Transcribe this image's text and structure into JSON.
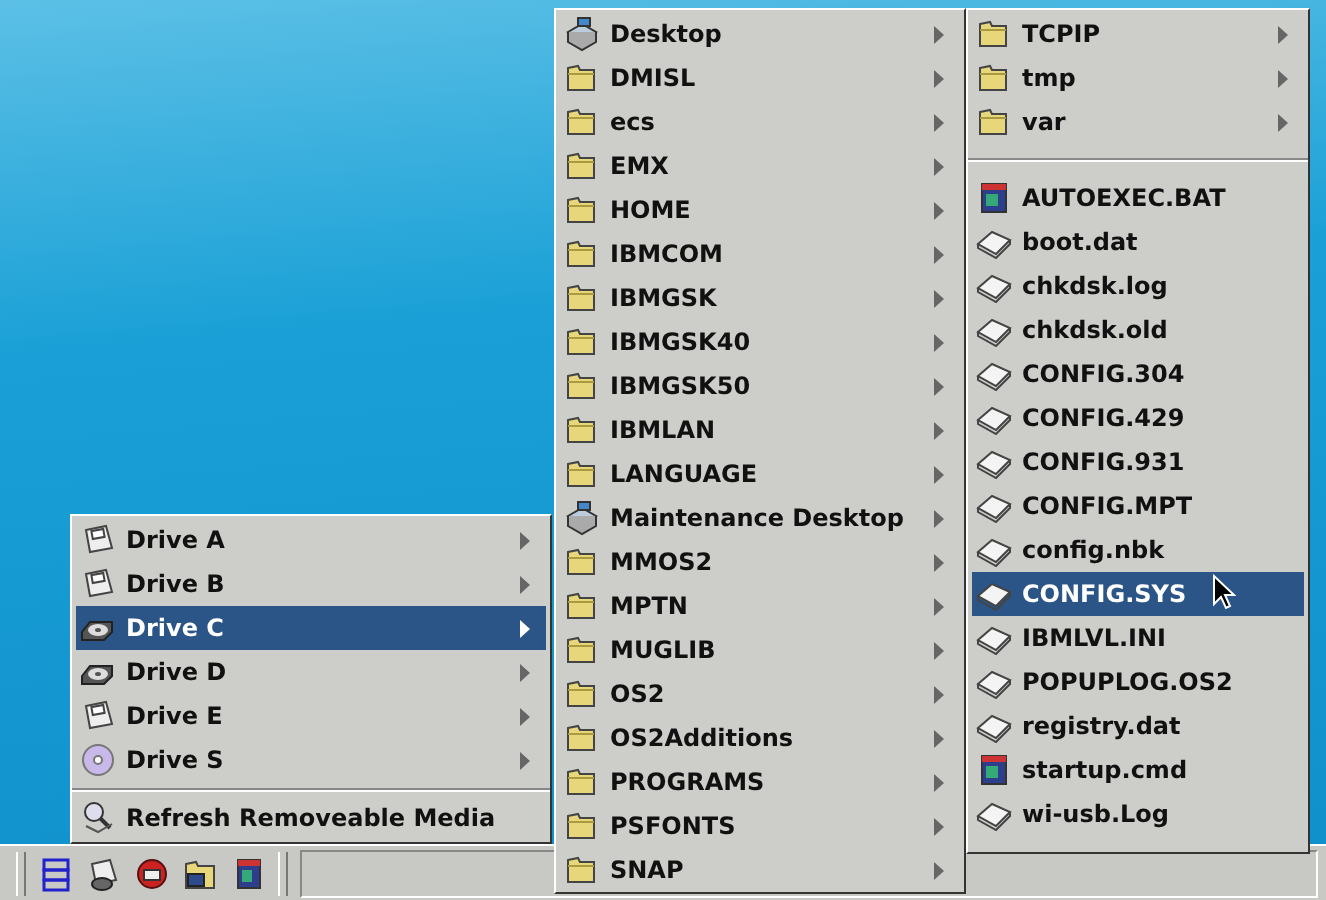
{
  "drives_menu": {
    "items": [
      {
        "label": "Drive A",
        "kind": "floppy",
        "submenu": true,
        "selected": false
      },
      {
        "label": "Drive B",
        "kind": "floppy",
        "submenu": true,
        "selected": false
      },
      {
        "label": "Drive C",
        "kind": "hard-disk",
        "submenu": true,
        "selected": true
      },
      {
        "label": "Drive D",
        "kind": "hard-disk",
        "submenu": true,
        "selected": false
      },
      {
        "label": "Drive E",
        "kind": "floppy",
        "submenu": true,
        "selected": false
      },
      {
        "label": "Drive S",
        "kind": "cd",
        "submenu": true,
        "selected": false
      }
    ],
    "actions": [
      {
        "label": "Refresh Removeable Media",
        "kind": "refresh",
        "submenu": false,
        "selected": false
      }
    ]
  },
  "folders_menu": {
    "items": [
      {
        "label": "Desktop",
        "kind": "desktop",
        "submenu": true,
        "selected": false
      },
      {
        "label": "DMISL",
        "kind": "folder",
        "submenu": true,
        "selected": false
      },
      {
        "label": "ecs",
        "kind": "folder",
        "submenu": true,
        "selected": false
      },
      {
        "label": "EMX",
        "kind": "folder",
        "submenu": true,
        "selected": false
      },
      {
        "label": "HOME",
        "kind": "folder",
        "submenu": true,
        "selected": false
      },
      {
        "label": "IBMCOM",
        "kind": "folder",
        "submenu": true,
        "selected": false
      },
      {
        "label": "IBMGSK",
        "kind": "folder",
        "submenu": true,
        "selected": false
      },
      {
        "label": "IBMGSK40",
        "kind": "folder",
        "submenu": true,
        "selected": false
      },
      {
        "label": "IBMGSK50",
        "kind": "folder",
        "submenu": true,
        "selected": false
      },
      {
        "label": "IBMLAN",
        "kind": "folder",
        "submenu": true,
        "selected": false
      },
      {
        "label": "LANGUAGE",
        "kind": "folder",
        "submenu": true,
        "selected": false
      },
      {
        "label": "Maintenance Desktop",
        "kind": "desktop",
        "submenu": true,
        "selected": false
      },
      {
        "label": "MMOS2",
        "kind": "folder",
        "submenu": true,
        "selected": false
      },
      {
        "label": "MPTN",
        "kind": "folder",
        "submenu": true,
        "selected": false
      },
      {
        "label": "MUGLIB",
        "kind": "folder",
        "submenu": true,
        "selected": false
      },
      {
        "label": "OS2",
        "kind": "folder",
        "submenu": true,
        "selected": false
      },
      {
        "label": "OS2Additions",
        "kind": "folder",
        "submenu": true,
        "selected": false
      },
      {
        "label": "PROGRAMS",
        "kind": "folder",
        "submenu": true,
        "selected": false
      },
      {
        "label": "PSFONTS",
        "kind": "folder",
        "submenu": true,
        "selected": false
      },
      {
        "label": "SNAP",
        "kind": "folder",
        "submenu": true,
        "selected": false
      }
    ]
  },
  "files_menu": {
    "folders": [
      {
        "label": "TCPIP",
        "kind": "folder",
        "submenu": true,
        "selected": false
      },
      {
        "label": "tmp",
        "kind": "folder",
        "submenu": true,
        "selected": false
      },
      {
        "label": "var",
        "kind": "folder",
        "submenu": true,
        "selected": false
      }
    ],
    "files": [
      {
        "label": "AUTOEXEC.BAT",
        "kind": "program",
        "submenu": false,
        "selected": false
      },
      {
        "label": "boot.dat",
        "kind": "file",
        "submenu": false,
        "selected": false
      },
      {
        "label": "chkdsk.log",
        "kind": "file",
        "submenu": false,
        "selected": false
      },
      {
        "label": "chkdsk.old",
        "kind": "file",
        "submenu": false,
        "selected": false
      },
      {
        "label": "CONFIG.304",
        "kind": "file",
        "submenu": false,
        "selected": false
      },
      {
        "label": "CONFIG.429",
        "kind": "file",
        "submenu": false,
        "selected": false
      },
      {
        "label": "CONFIG.931",
        "kind": "file",
        "submenu": false,
        "selected": false
      },
      {
        "label": "CONFIG.MPT",
        "kind": "file",
        "submenu": false,
        "selected": false
      },
      {
        "label": "config.nbk",
        "kind": "file",
        "submenu": false,
        "selected": false
      },
      {
        "label": "CONFIG.SYS",
        "kind": "file",
        "submenu": false,
        "selected": true
      },
      {
        "label": "IBMLVL.INI",
        "kind": "file",
        "submenu": false,
        "selected": false
      },
      {
        "label": "POPUPLOG.OS2",
        "kind": "file",
        "submenu": false,
        "selected": false
      },
      {
        "label": "registry.dat",
        "kind": "file",
        "submenu": false,
        "selected": false
      },
      {
        "label": "startup.cmd",
        "kind": "program",
        "submenu": false,
        "selected": false
      },
      {
        "label": "wi-usb.Log",
        "kind": "file",
        "submenu": false,
        "selected": false
      }
    ]
  },
  "taskbar": {
    "buttons": [
      {
        "kind": "menu"
      },
      {
        "kind": "drives"
      },
      {
        "kind": "shutdown"
      },
      {
        "kind": "folder-window"
      },
      {
        "kind": "program"
      }
    ]
  }
}
